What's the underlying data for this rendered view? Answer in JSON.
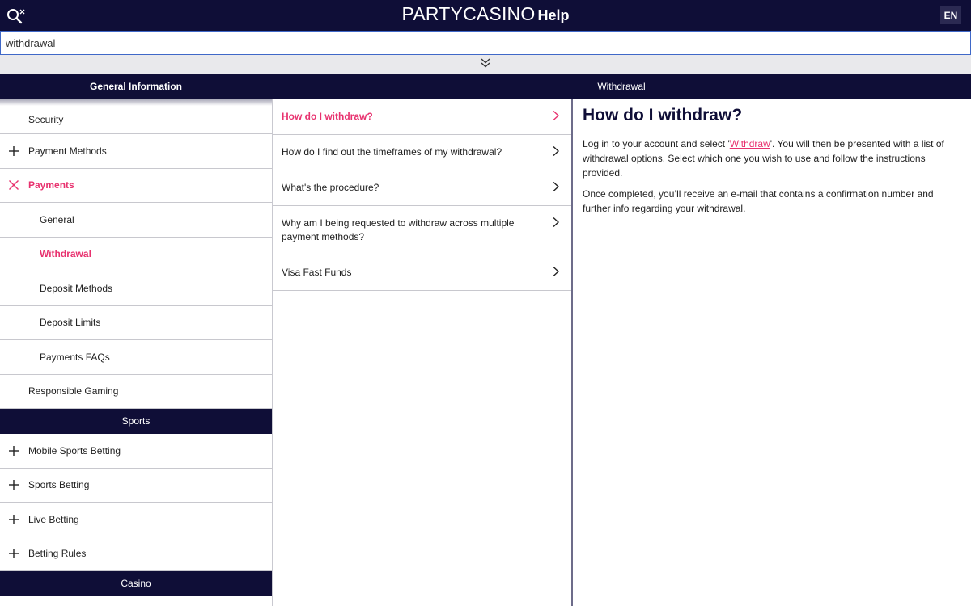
{
  "header": {
    "brand": "PARTYCASINO",
    "help": "Help",
    "language": "EN"
  },
  "search": {
    "value": "withdrawal"
  },
  "columns": {
    "left": "General Information",
    "right": "Withdrawal"
  },
  "nav": {
    "items": [
      {
        "label": "Security",
        "icon": ""
      },
      {
        "label": "Payment Methods",
        "icon": "plus-icon"
      },
      {
        "label": "Payments",
        "icon": "close-icon"
      },
      {
        "label": "General",
        "icon": ""
      },
      {
        "label": "Withdrawal",
        "icon": ""
      },
      {
        "label": "Deposit Methods",
        "icon": ""
      },
      {
        "label": "Deposit Limits",
        "icon": ""
      },
      {
        "label": "Payments FAQs",
        "icon": ""
      },
      {
        "label": "Responsible Gaming",
        "icon": ""
      }
    ],
    "sports_heading": "Sports",
    "sports_items": [
      {
        "label": "Mobile Sports Betting",
        "icon": "plus-icon"
      },
      {
        "label": "Sports Betting",
        "icon": "plus-icon"
      },
      {
        "label": "Live Betting",
        "icon": "plus-icon"
      },
      {
        "label": "Betting Rules",
        "icon": "plus-icon"
      }
    ],
    "casino_heading": "Casino"
  },
  "questions": [
    "How do I withdraw?",
    "How do I find out the timeframes of my withdrawal?",
    "What's the procedure?",
    "Why am I being requested to withdraw across multiple payment methods?",
    "Visa Fast Funds"
  ],
  "article": {
    "title": "How do I withdraw?",
    "p1_before": "Log in to your account and select '",
    "p1_link": "Withdraw",
    "p1_after": "'. You will then be presented with a list of withdrawal options. Select which one you wish to use and follow the instructions provided.",
    "p2": "Once completed, you’ll receive an e-mail that contains a confirmation number and further info regarding your withdrawal."
  },
  "colors": {
    "navy": "#0f0e37",
    "accent": "#e8326f"
  }
}
